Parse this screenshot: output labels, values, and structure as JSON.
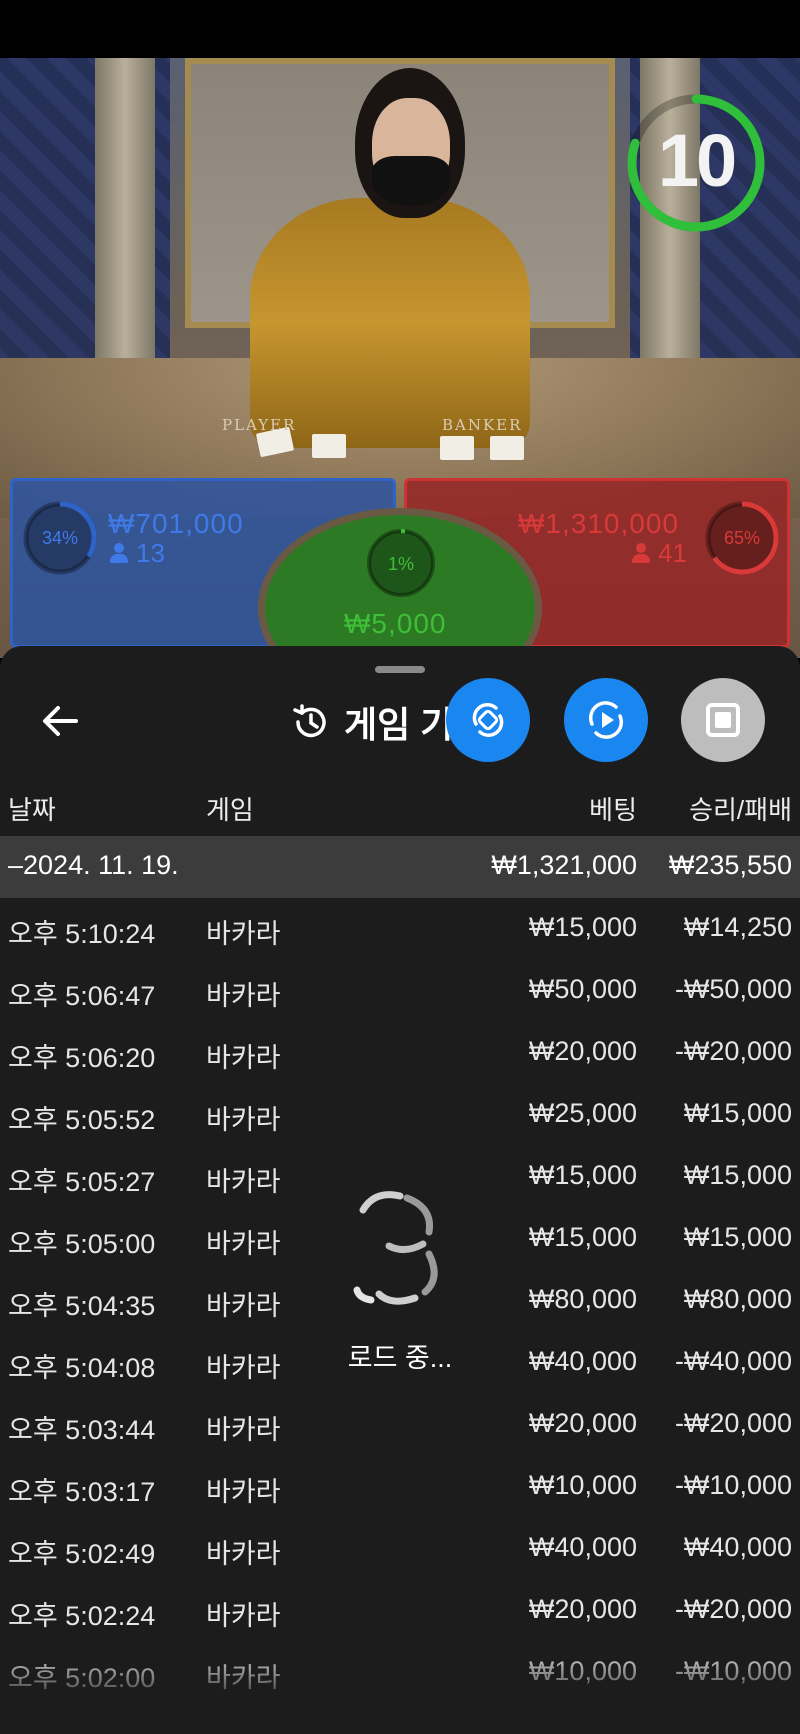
{
  "timer": {
    "countdown": "10",
    "progress": 0.8,
    "color": "#2fbf3a"
  },
  "table_labels": {
    "player": "PLAYER",
    "banker": "BANKER"
  },
  "bets": {
    "player": {
      "percent": "34%",
      "amount": "₩701,000",
      "players": "13",
      "color": "#2e63c8"
    },
    "tie": {
      "percent": "1%",
      "amount": "₩5,000",
      "color": "#3fbf38"
    },
    "banker": {
      "percent": "65%",
      "amount": "₩1,310,000",
      "players": "41",
      "color": "#d83a3a"
    }
  },
  "sheet": {
    "title": "게임 기",
    "icons": [
      "back-arrow-icon",
      "history-icon",
      "swap-icon",
      "rotate-play-icon",
      "stop-icon"
    ],
    "columns": {
      "date": "날짜",
      "game": "게임",
      "bet": "베팅",
      "winloss": "승리/패배"
    },
    "date_group": {
      "date": "–2024. 11. 19.",
      "total_bet": "₩1,321,000",
      "total_winloss": "₩235,550"
    },
    "rows": [
      {
        "time": "오후 5:10:24",
        "game": "바카라",
        "bet": "₩15,000",
        "winloss": "₩14,250"
      },
      {
        "time": "오후 5:06:47",
        "game": "바카라",
        "bet": "₩50,000",
        "winloss": "-₩50,000"
      },
      {
        "time": "오후 5:06:20",
        "game": "바카라",
        "bet": "₩20,000",
        "winloss": "-₩20,000"
      },
      {
        "time": "오후 5:05:52",
        "game": "바카라",
        "bet": "₩25,000",
        "winloss": "₩15,000"
      },
      {
        "time": "오후 5:05:27",
        "game": "바카라",
        "bet": "₩15,000",
        "winloss": "₩15,000"
      },
      {
        "time": "오후 5:05:00",
        "game": "바카라",
        "bet": "₩15,000",
        "winloss": "₩15,000"
      },
      {
        "time": "오후 5:04:35",
        "game": "바카라",
        "bet": "₩80,000",
        "winloss": "₩80,000"
      },
      {
        "time": "오후 5:04:08",
        "game": "바카라",
        "bet": "₩40,000",
        "winloss": "-₩40,000"
      },
      {
        "time": "오후 5:03:44",
        "game": "바카라",
        "bet": "₩20,000",
        "winloss": "-₩20,000"
      },
      {
        "time": "오후 5:03:17",
        "game": "바카라",
        "bet": "₩10,000",
        "winloss": "-₩10,000"
      },
      {
        "time": "오후 5:02:49",
        "game": "바카라",
        "bet": "₩40,000",
        "winloss": "₩40,000"
      },
      {
        "time": "오후 5:02:24",
        "game": "바카라",
        "bet": "₩20,000",
        "winloss": "-₩20,000"
      },
      {
        "time": "오후 5:02:00",
        "game": "바카라",
        "bet": "₩10,000",
        "winloss": "-₩10,000"
      }
    ],
    "loading_text": "로드 중..."
  }
}
